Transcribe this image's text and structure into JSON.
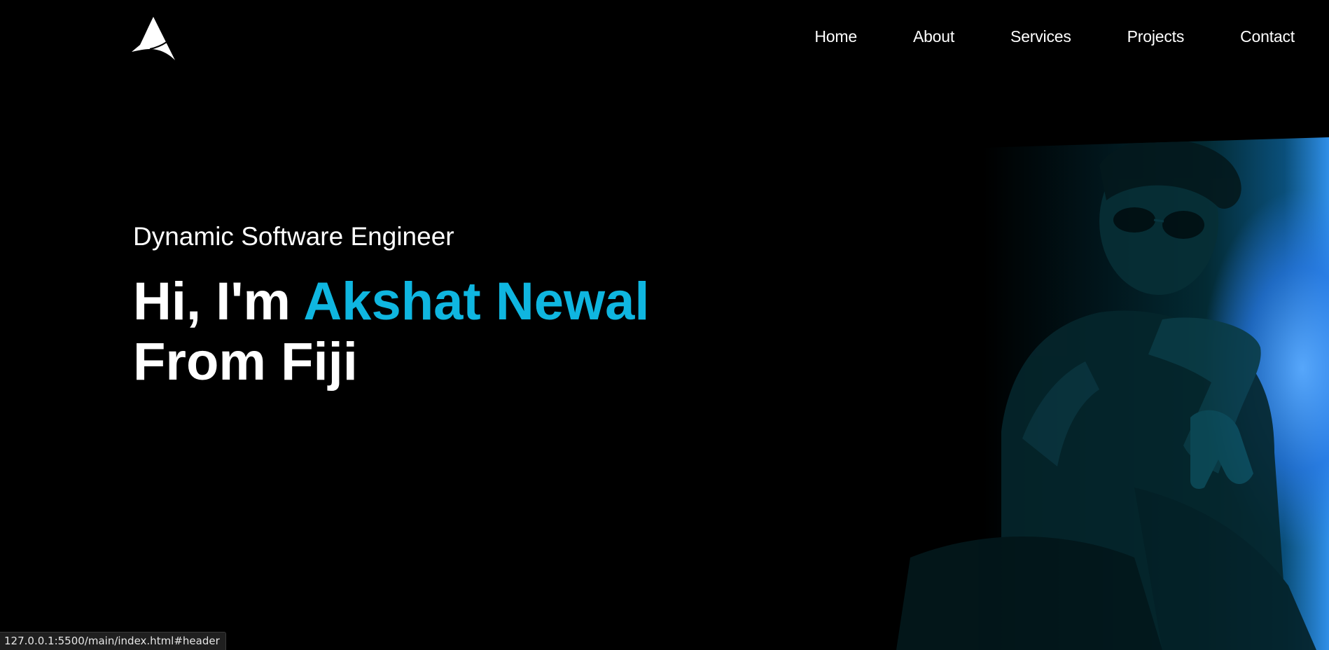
{
  "header": {
    "logo_icon": "arrowhead-logo-icon",
    "nav": [
      {
        "label": "Home"
      },
      {
        "label": "About"
      },
      {
        "label": "Services"
      },
      {
        "label": "Projects"
      },
      {
        "label": "Contact"
      }
    ]
  },
  "hero": {
    "subtitle": "Dynamic Software Engineer",
    "headline_prefix": "Hi, I'm ",
    "headline_name": "Akshat Newal",
    "headline_line2": "From Fiji",
    "accent_color": "#0fb6e0"
  },
  "status_bar": {
    "url": "127.0.0.1:5500/main/index.html#header"
  }
}
